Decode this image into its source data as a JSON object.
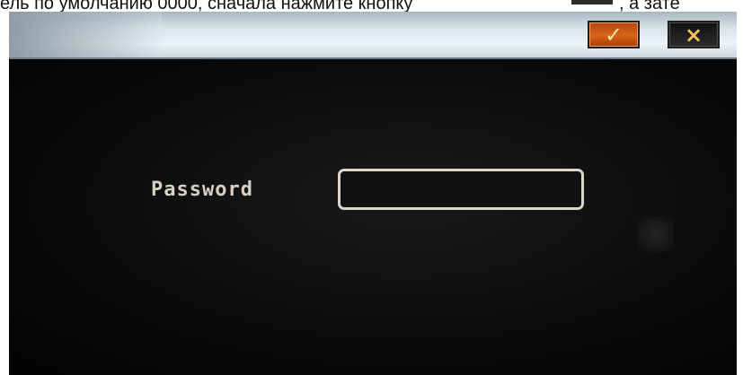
{
  "document_text": {
    "left": "ель по умолчанию 0000, сначала нажмите кнопку",
    "right": ", а зате"
  },
  "titlebar": {
    "confirm_icon": "check-icon",
    "confirm_glyph": "✓",
    "close_icon": "close-icon",
    "close_glyph": "×"
  },
  "login": {
    "password_label": "Password",
    "password_value": ""
  },
  "colors": {
    "confirm_button": "#d86418",
    "close_button": "#1d1d1d",
    "label_text": "#d8d0c4",
    "field_border": "#dcd6cb"
  }
}
